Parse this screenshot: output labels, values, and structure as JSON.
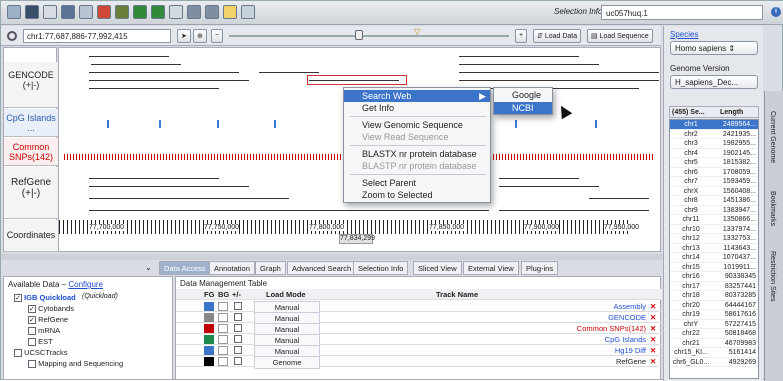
{
  "toolbar": {
    "selection_label": "Selection Info:",
    "selection_value": "uc057huq.1"
  },
  "nav": {
    "location": "chr1:77,687,886-77,992,415",
    "load_data": "Load Data",
    "load_sequence": "Load Sequence"
  },
  "tracks": [
    {
      "label": "GENCODE",
      "sub": "(+|-)"
    },
    {
      "label": "CpG Islands ..."
    },
    {
      "label": "Common SNPs(142)"
    },
    {
      "label": "RefGene",
      "sub": "(+|-)"
    },
    {
      "label": "Coordinates"
    }
  ],
  "coords": [
    "77,700,000",
    "77,750,000",
    "77,800,000",
    "77,850,000",
    "77,900,000",
    "77,950,000"
  ],
  "center_coord": "77,834,299",
  "menu": {
    "search_web": "Search Web",
    "get_info": "Get Info",
    "view_genomic": "View Genomic Sequence",
    "view_read": "View Read Sequence",
    "blastx": "BLASTX nr protein database",
    "blastp": "BLASTP nr protein database",
    "select_parent": "Select Parent",
    "zoom": "Zoom to Selected",
    "google": "Google",
    "ncbi": "NCBI"
  },
  "right": {
    "species_label": "Species",
    "species_value": "Homo sapiens",
    "genome_label": "Genome Version",
    "genome_value": "H_sapiens_Dec...",
    "col1": "(455) Se...",
    "col2": "Length",
    "chroms": [
      [
        "chr1",
        "2489564..."
      ],
      [
        "chr2",
        "2421935..."
      ],
      [
        "chr3",
        "1982955..."
      ],
      [
        "chr4",
        "1902145..."
      ],
      [
        "chr5",
        "1815382..."
      ],
      [
        "chr6",
        "1708059..."
      ],
      [
        "chr7",
        "1593459..."
      ],
      [
        "chrX",
        "1560408..."
      ],
      [
        "chr8",
        "1451386..."
      ],
      [
        "chr9",
        "1383947..."
      ],
      [
        "chr11",
        "1350866..."
      ],
      [
        "chr10",
        "1337974..."
      ],
      [
        "chr12",
        "1332753..."
      ],
      [
        "chr13",
        "1143643..."
      ],
      [
        "chr14",
        "1070437..."
      ],
      [
        "chr15",
        "1019911..."
      ],
      [
        "chr16",
        "90338345"
      ],
      [
        "chr17",
        "83257441"
      ],
      [
        "chr18",
        "80373285"
      ],
      [
        "chr20",
        "64444167"
      ],
      [
        "chr19",
        "58617616"
      ],
      [
        "chrY",
        "57227415"
      ],
      [
        "chr22",
        "50818468"
      ],
      [
        "chr21",
        "46709983"
      ],
      [
        "chr15_KI...",
        "5161414"
      ],
      [
        "chr6_GL0...",
        "4929269"
      ]
    ]
  },
  "vtabs": [
    "Current Genome",
    "Bookmarks",
    "Restriction Sites"
  ],
  "tabs": [
    "Data Access",
    "Annotation",
    "Graph",
    "Advanced Search",
    "Selection Info",
    "Sliced View",
    "External View",
    "Plug-ins"
  ],
  "available": {
    "title": "Available Data",
    "configure": "Configure",
    "items": [
      "IGB Quickload",
      "(Quickload)",
      "Cytobands",
      "RefGene",
      "mRNA",
      "EST",
      "UCSCTracks",
      "Mapping and Sequencing"
    ]
  },
  "dmt": {
    "title": "Data Management Table",
    "headers": [
      "FG",
      "BG",
      "+/-",
      "Load Mode",
      "Track Name"
    ],
    "rows": [
      [
        "Manual",
        "Assembly"
      ],
      [
        "Manual",
        "GENCODE"
      ],
      [
        "Manual",
        "Common SNPs(142)"
      ],
      [
        "Manual",
        "CpG Islands"
      ],
      [
        "Manual",
        "Hg19 Diff"
      ],
      [
        "Genome",
        "RefGene"
      ]
    ]
  },
  "colors": {
    "accent": "#3b74c8",
    "snp": "#cc0000",
    "trackname": "#1f4fd0"
  }
}
